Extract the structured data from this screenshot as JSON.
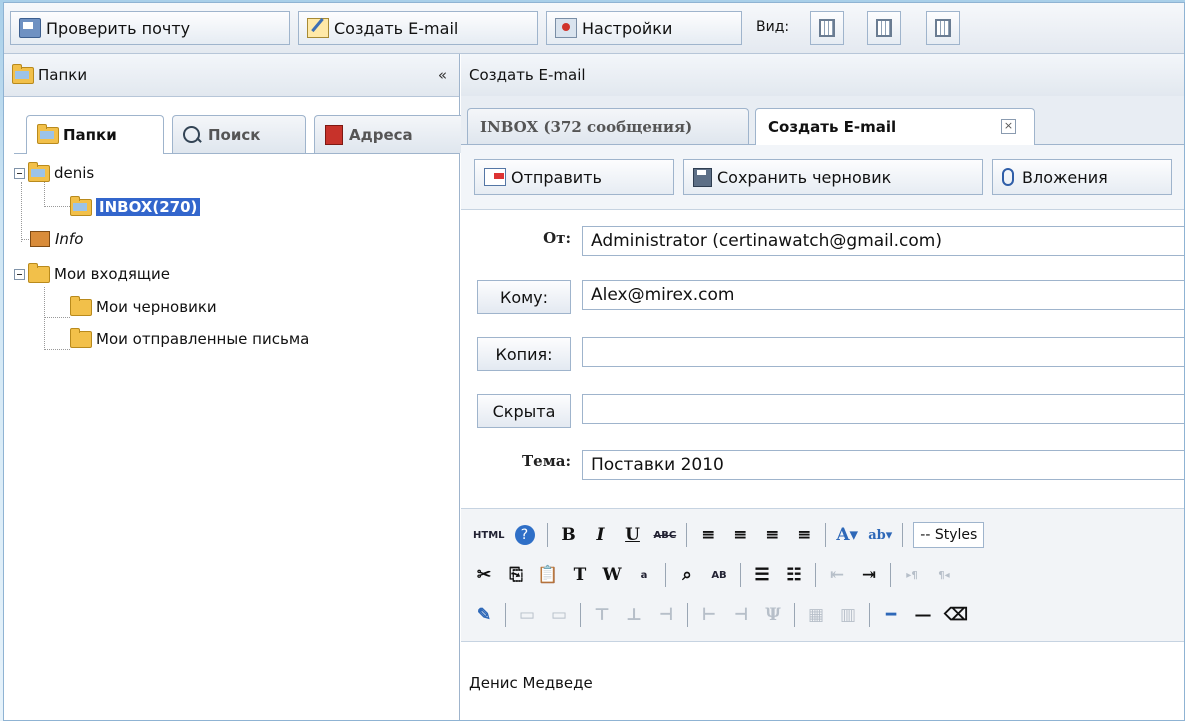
{
  "toolbar": {
    "check_mail": "Проверить почту",
    "compose": "Создать E-mail",
    "settings": "Настройки",
    "view_label": "Вид:"
  },
  "left": {
    "header": "Папки",
    "collapse": "«",
    "tabs": [
      "Папки",
      "Поиск",
      "Адреса"
    ],
    "tree": {
      "account": "denis",
      "inbox": "INBOX(270)",
      "info": "Info",
      "my_inbox": "Мои входящие",
      "drafts": "Мои черновики",
      "sent": "Мои отправленные письма"
    }
  },
  "right": {
    "header": "Создать E-mail",
    "tabs": [
      "INBOX (372 сообщения)",
      "Создать E-mail"
    ],
    "close": "×",
    "actions": {
      "send": "Отправить",
      "save_draft": "Сохранить черновик",
      "attachments": "Вложения"
    },
    "form": {
      "from_label": "От:",
      "from_value": "Administrator (certinawatch@gmail.com)",
      "to_label": "Кому:",
      "to_value": "Alex@mirex.com",
      "cc_label": "Копия:",
      "cc_value": "",
      "bcc_label": "Скрыта",
      "bcc_value": "",
      "subject_label": "Тема:",
      "subject_value": "Поставки 2010"
    },
    "editor": {
      "html_label": "HTML",
      "styles_label": "-- Styles",
      "body": "Денис Медведе"
    }
  }
}
